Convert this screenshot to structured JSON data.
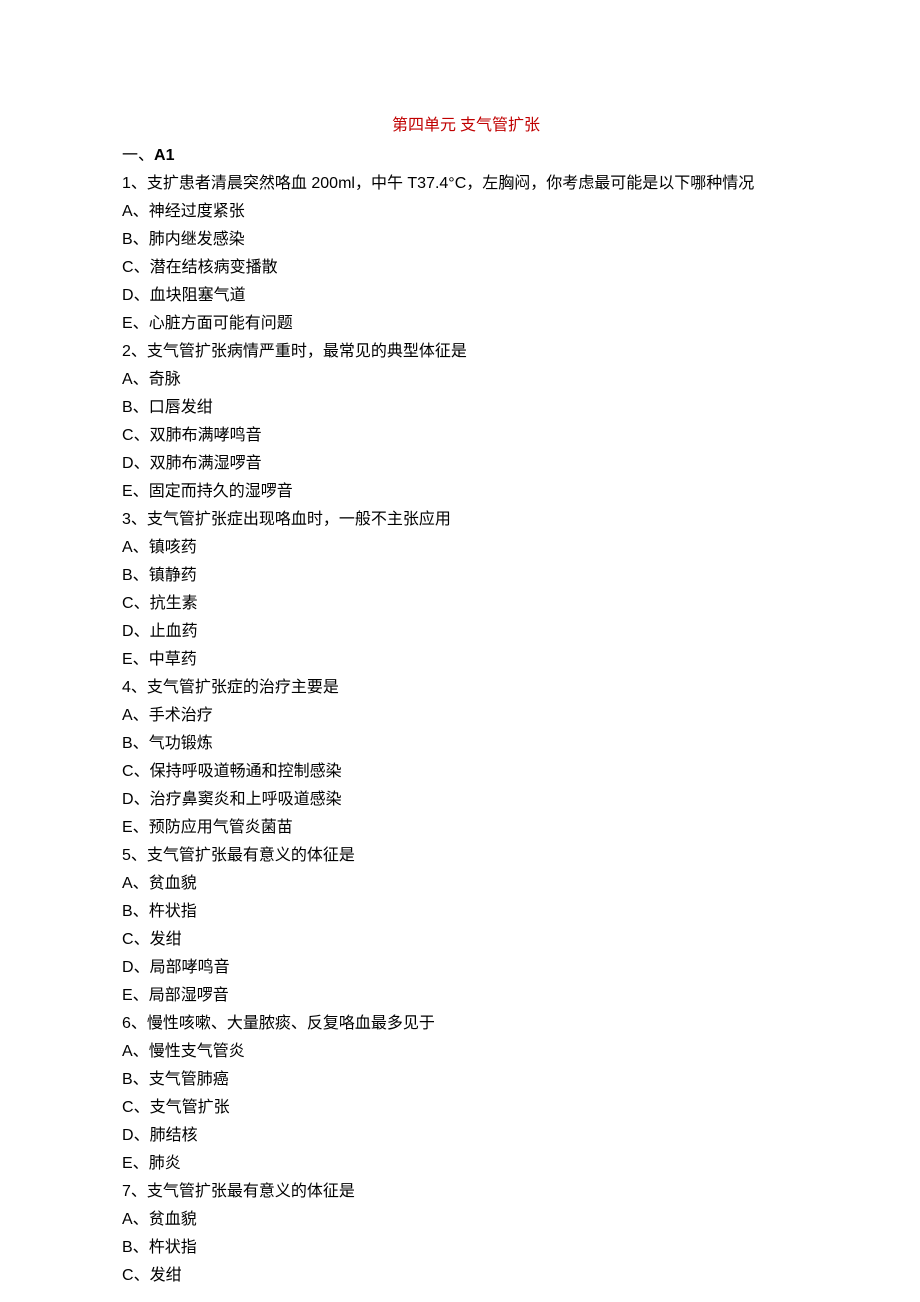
{
  "title": "第四单元 支气管扩张",
  "section": {
    "prefix": "一、",
    "label": "A1"
  },
  "questions": [
    {
      "num": "1",
      "text": "支扩患者清晨突然咯血 200ml，中午 T37.4°C，左胸闷，你考虑最可能是以下哪种情况",
      "options": [
        {
          "letter": "A",
          "text": "神经过度紧张"
        },
        {
          "letter": "B",
          "text": "肺内继发感染"
        },
        {
          "letter": "C",
          "text": "潜在结核病变播散"
        },
        {
          "letter": "D",
          "text": "血块阻塞气道"
        },
        {
          "letter": "E",
          "text": "心脏方面可能有问题"
        }
      ]
    },
    {
      "num": "2",
      "text": "支气管扩张病情严重时，最常见的典型体征是",
      "options": [
        {
          "letter": "A",
          "text": "奇脉"
        },
        {
          "letter": "B",
          "text": "口唇发绀"
        },
        {
          "letter": "C",
          "text": "双肺布满哮鸣音"
        },
        {
          "letter": "D",
          "text": "双肺布满湿啰音"
        },
        {
          "letter": "E",
          "text": "固定而持久的湿啰音"
        }
      ]
    },
    {
      "num": "3",
      "text": "支气管扩张症出现咯血时，一般不主张应用",
      "options": [
        {
          "letter": "A",
          "text": "镇咳药"
        },
        {
          "letter": "B",
          "text": "镇静药"
        },
        {
          "letter": "C",
          "text": "抗生素"
        },
        {
          "letter": "D",
          "text": "止血药"
        },
        {
          "letter": "E",
          "text": "中草药"
        }
      ]
    },
    {
      "num": "4",
      "text": "支气管扩张症的治疗主要是",
      "options": [
        {
          "letter": "A",
          "text": "手术治疗"
        },
        {
          "letter": "B",
          "text": "气功锻炼"
        },
        {
          "letter": "C",
          "text": "保持呼吸道畅通和控制感染"
        },
        {
          "letter": "D",
          "text": "治疗鼻窦炎和上呼吸道感染"
        },
        {
          "letter": "E",
          "text": "预防应用气管炎菌苗"
        }
      ]
    },
    {
      "num": "5",
      "text": "支气管扩张最有意义的体征是",
      "options": [
        {
          "letter": "A",
          "text": "贫血貌"
        },
        {
          "letter": "B",
          "text": "杵状指"
        },
        {
          "letter": "C",
          "text": "发绀"
        },
        {
          "letter": "D",
          "text": "局部哮鸣音"
        },
        {
          "letter": "E",
          "text": "局部湿啰音"
        }
      ]
    },
    {
      "num": "6",
      "text": "慢性咳嗽、大量脓痰、反复咯血最多见于",
      "options": [
        {
          "letter": "A",
          "text": "慢性支气管炎"
        },
        {
          "letter": "B",
          "text": "支气管肺癌"
        },
        {
          "letter": "C",
          "text": "支气管扩张"
        },
        {
          "letter": "D",
          "text": "肺结核"
        },
        {
          "letter": "E",
          "text": "肺炎"
        }
      ]
    },
    {
      "num": "7",
      "text": "支气管扩张最有意义的体征是",
      "options": [
        {
          "letter": "A",
          "text": "贫血貌"
        },
        {
          "letter": "B",
          "text": "杵状指"
        },
        {
          "letter": "C",
          "text": "发绀"
        }
      ]
    }
  ]
}
